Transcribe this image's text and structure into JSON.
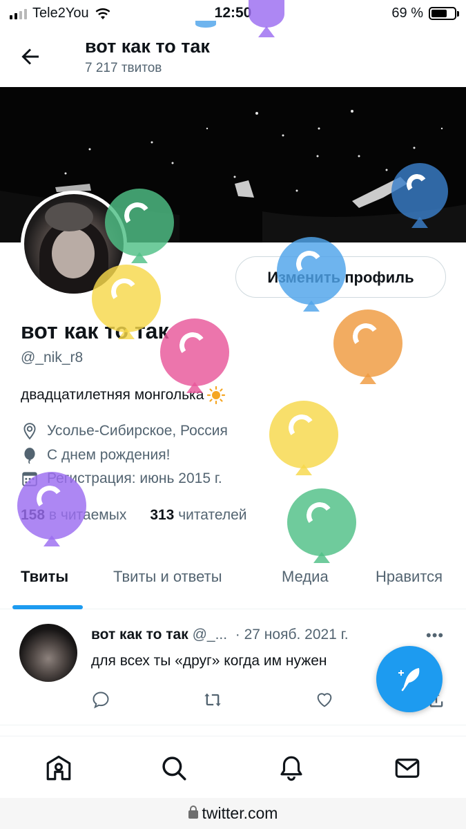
{
  "status_bar": {
    "carrier": "Tele2You",
    "time": "12:50",
    "battery": "69 %"
  },
  "header": {
    "title": "вот как то так",
    "tweet_count": "7 217 твитов"
  },
  "profile": {
    "edit_button": "Изменить профиль",
    "name": "вот как то так",
    "handle": "@_nik_r8",
    "bio": "двадцатилетняя монголька",
    "bio_emoji": "☀️",
    "location": "Усолье-Сибирское, Россия",
    "birthday": "С днем рождения!",
    "joined": "Регистрация: июнь 2015 г.",
    "following_count": "158",
    "following_label": "в читаемых",
    "followers_count": "313",
    "followers_label": "читателей"
  },
  "tabs": [
    "Твиты",
    "Твиты и ответы",
    "Медиа",
    "Нравится"
  ],
  "tweet": {
    "author": "вот как то так",
    "handle": "@_...",
    "date": "· 27 нояб. 2021 г.",
    "text": "для всех ты «друг» когда им нужен"
  },
  "url": "twitter.com",
  "colors": {
    "accent": "#1d9bf0",
    "balloon_green": "#4fbf86",
    "balloon_yellow": "#f7d84a",
    "balloon_pink": "#e8579a",
    "balloon_blue": "#4ea3ea",
    "balloon_orange": "#ef9a3e",
    "balloon_purple": "#9b6cf0",
    "balloon_darkblue": "#3a7fc9"
  },
  "icons": [
    "arrow-left-icon",
    "location-icon",
    "balloon-icon",
    "calendar-icon",
    "reply-icon",
    "retweet-icon",
    "like-icon",
    "share-icon",
    "compose-icon",
    "home-icon",
    "search-icon",
    "notifications-icon",
    "messages-icon"
  ]
}
